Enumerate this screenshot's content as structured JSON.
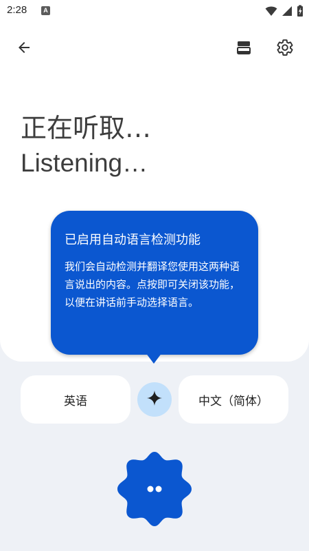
{
  "status_bar": {
    "time": "2:28",
    "notification_badge": "A",
    "icons": [
      "wifi-icon",
      "cell-signal-icon",
      "battery-charging-icon"
    ]
  },
  "app_bar": {
    "icons": [
      "arrow-back-icon",
      "layout-toggle-icon",
      "settings-gear-icon"
    ]
  },
  "listening": {
    "primary_text": "正在听取…",
    "secondary_text": "Listening…"
  },
  "tooltip": {
    "title": "已启用自动语言检测功能",
    "body": "我们会自动检测并翻译您使用这两种语言说出的内容。点按即可关闭该功能，以便在讲话前手动选择语言。"
  },
  "languages": {
    "source": "英语",
    "target": "中文（简体）",
    "auto_detect_icon": "sparkle-icon"
  },
  "mic": {
    "icon": "listening-dots-icon"
  },
  "colors": {
    "accent": "#0b57d0",
    "auto_detect_bg": "#c2e0fb",
    "background": "#eef1f6",
    "surface": "#ffffff"
  }
}
